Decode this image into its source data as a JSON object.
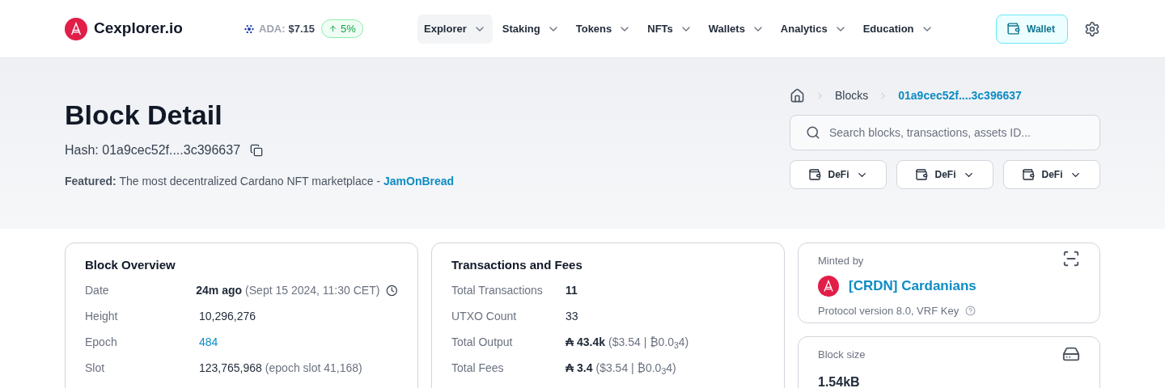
{
  "header": {
    "logo": "**C**explorer.io",
    "price": {
      "label": "ADA:",
      "value": "$7.15",
      "change": "5%"
    },
    "nav": [
      {
        "label": "Explorer",
        "selected": true
      },
      {
        "label": "Staking",
        "selected": false
      },
      {
        "label": "Tokens",
        "selected": false
      },
      {
        "label": "NFTs",
        "selected": false
      },
      {
        "label": "Wallets",
        "selected": false
      },
      {
        "label": "Analytics",
        "selected": false
      },
      {
        "label": "Education",
        "selected": false
      }
    ],
    "wallet_button": "Wallet"
  },
  "hero": {
    "title": "Block Detail",
    "hash": "Hash: 01a9cec52f....3c396637",
    "featured": {
      "label": "Featured:",
      "text": "The most decentralized Cardano NFT marketplace -",
      "link": "JamOnBread"
    },
    "breadcrumbs": [
      "Blocks",
      "01a9cec52f....3c396637"
    ],
    "search": {
      "placeholder": "Search blocks, transactions, assets ID..."
    },
    "filters": [
      "DeFi",
      "DeFi",
      "DeFi"
    ]
  },
  "overview": {
    "title": "Block Overview",
    "rows": [
      {
        "label": "Date",
        "value": "24m ago",
        "note": "(Sept 15 2024, 11:30 CET)",
        "kind": "time"
      },
      {
        "label": "Height",
        "value": "10,296,276",
        "kind": "plain"
      },
      {
        "label": "Epoch",
        "value": "484",
        "kind": "link"
      },
      {
        "label": "Slot",
        "value": "123,765,968",
        "note": "(epoch slot 41,168)",
        "kind": "plain"
      }
    ]
  },
  "transactions": {
    "title": "Transactions and Fees",
    "rows": [
      {
        "label": "Total Transactions",
        "value": "11",
        "kind": "bold"
      },
      {
        "label": "UTXO Count",
        "value": "33",
        "kind": "plain"
      },
      {
        "label": "Total Output",
        "value": "₳ 43.4k",
        "note": "($3.54 | ₿0.0$_{3}$4)",
        "kind": "bold"
      },
      {
        "label": "Total Fees",
        "value": "₳ 3.4",
        "note": "($3.54 | ₿0.0$_{3}$4)",
        "kind": "bold"
      }
    ]
  },
  "minted": {
    "label": "Minted by",
    "pool": "[CRDN] Cardanians",
    "protocol": "Protocol version 8.0, VRF Key"
  },
  "block_size": {
    "label": "Block size",
    "value": "1.54kB"
  }
}
